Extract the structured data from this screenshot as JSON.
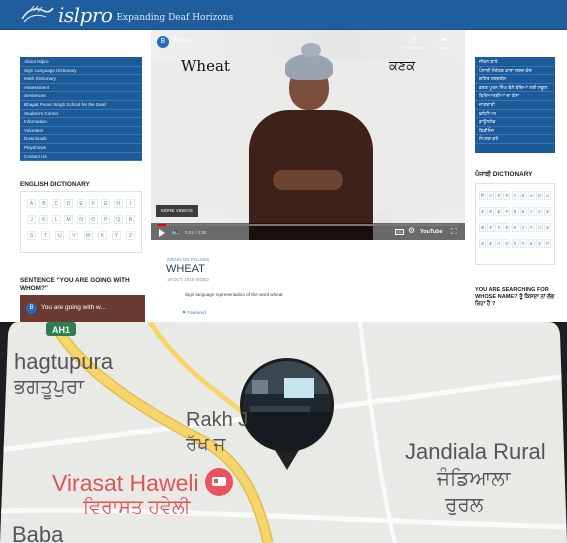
{
  "site": {
    "logo_text": "islpro",
    "logo_tagline": "Expanding Deaf Horizons",
    "left_menu": [
      "About Islpro",
      "Sign Language Dictionary",
      "Math Dictionary",
      "Assessment",
      "Sentences",
      "Bhagat Puran Singh School for the Deaf",
      "Student's Corner",
      "Information",
      "Volunteer",
      "Downloads",
      "Playshows",
      "Contact Us"
    ],
    "right_menu": [
      "ਜੀਵਨ ਬਾਰੇ",
      "ਪੰਜਾਬੀ ਸੰਕੇਤਕ ਭਾਸ਼ਾ ਸ਼ਬਦ-ਕੋਸ਼",
      "ਗਣਿਤ ਸ਼ਬਦਕੋਸ਼",
      "ਭਗਤ ਪੂਰਨ ਸਿੰਘ ਬੋਲੇ ਬੱਚਿਆਂ ਲਈ ਸਕੂਲ",
      "ਵਿਦਿਆਰਥੀਆਂ ਦਾ ਕੋਨਾ",
      "ਜਾਣਕਾਰੀ",
      "ਵਲੰਟੀਅਰ",
      "ਡਾਊਨਲੋਡ",
      "ਵਿਡੀਓਜ਼",
      "ਸੰਪਰਕ ਕਰੋ"
    ],
    "english_dictionary_title": "ENGLISH DICTIONARY",
    "english_letters": [
      [
        "A",
        "B",
        "C",
        "D",
        "E",
        "F",
        "G",
        "H",
        "I"
      ],
      [
        "J",
        "K",
        "L",
        "M",
        "N",
        "O",
        "P",
        "Q",
        "R"
      ],
      [
        "S",
        "T",
        "U",
        "V",
        "W",
        "X",
        "Y",
        "Z"
      ]
    ],
    "punjabi_dictionary_title": "ਪੰਜਾਬੀ DICTIONARY",
    "punjabi_letters": [
      [
        "ੳ",
        "ਅ",
        "ੲ",
        "ਸ",
        "ਹ",
        "ਕ",
        "ਖ",
        "ਗ",
        "ਘ"
      ],
      [
        "ਙ",
        "ਚ",
        "ਛ",
        "ਜ",
        "ਝ",
        "ਞ",
        "ਟ",
        "ਠ",
        "ਡ"
      ],
      [
        "ਢ",
        "ਣ",
        "ਤ",
        "ਥ",
        "ਦ",
        "ਧ",
        "ਨ",
        "ਪ",
        "ਫ"
      ],
      [
        "ਬ",
        "ਭ",
        "ਮ",
        "ਯ",
        "ਰ",
        "ਲ",
        "ਵ",
        "ੜ",
        "ਸ਼"
      ]
    ],
    "sentence_title": "SENTENCE \"YOU ARE GOING WITH WHOM?\"",
    "sentence_video_title": "You are going with w...",
    "sentence_channel_initial": "B",
    "search_title": "YOU ARE SEARCHING FOR WHOSE NAME? ਤੂੰ ਕਿਸਦਾ ਨਾਂ ਲੱਭ ਰਿਹਾ ਹੈਂ ?",
    "video": {
      "channel_initial": "B",
      "title": "Wheat",
      "word_english": "Wheat",
      "word_punjabi": "ਕਣਕ",
      "watch_later": "Watch later",
      "share": "Share",
      "more_videos": "MORE VIDEOS",
      "time": "0:01 / 0:30",
      "youtube": "YouTube",
      "progress_fraction": 0.03
    },
    "post": {
      "category": "GRAIN OR PULSES",
      "title": "WHEAT",
      "meta": "18 OCT, 2015  VIDEO",
      "description": "Sign language representation of the word wheat",
      "tag": "Featured"
    }
  },
  "map": {
    "highway_badge": "AH1",
    "place_1_en": "hagtupura",
    "place_1_pa": "ਭਗਤੂਪੁਰਾ",
    "place_2_en": "Rakh J",
    "place_2_pa": "ਰੱਖ ਜ",
    "place_3_en": "Jandiala Rural",
    "place_3_pa1": "ਜੰਡਿਆਲਾ",
    "place_3_pa2": "ਰੁਰਲ",
    "poi_en": "Virasat Haweli",
    "poi_pa": "ਵਿਰਾਸਤ ਹਵੇਲੀ",
    "place_4_en": "Baba",
    "colors": {
      "land": "#e9eae5",
      "road": "#f6d66b",
      "poi": "#e8535c"
    }
  }
}
